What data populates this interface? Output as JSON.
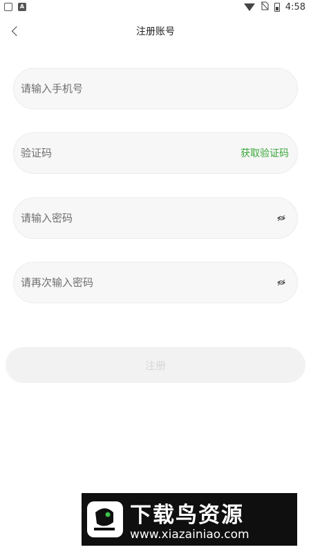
{
  "status_bar": {
    "time": "4:58",
    "left_icons": [
      "bag-icon",
      "a-icon"
    ],
    "right_icons": [
      "wifi-icon",
      "no-sim-icon",
      "battery-icon"
    ]
  },
  "header": {
    "title": "注册账号",
    "back_icon": "chevron-left-icon"
  },
  "form": {
    "phone": {
      "placeholder": "请输入手机号",
      "value": ""
    },
    "code": {
      "placeholder": "验证码",
      "value": "",
      "action_label": "获取验证码"
    },
    "password": {
      "placeholder": "请输入密码",
      "value": "",
      "toggle_icon": "eye-hidden-icon"
    },
    "password_confirm": {
      "placeholder": "请再次输入密码",
      "value": "",
      "toggle_icon": "eye-hidden-icon"
    },
    "submit_label": "注册"
  },
  "colors": {
    "accent": "#3aa63a",
    "field_bg": "#f7f7f7",
    "button_disabled_bg": "#f2f2f2",
    "button_disabled_text": "#d6d6d6"
  },
  "watermark": {
    "title": "下载鸟资源",
    "url": "www.xiazainiao.com"
  }
}
